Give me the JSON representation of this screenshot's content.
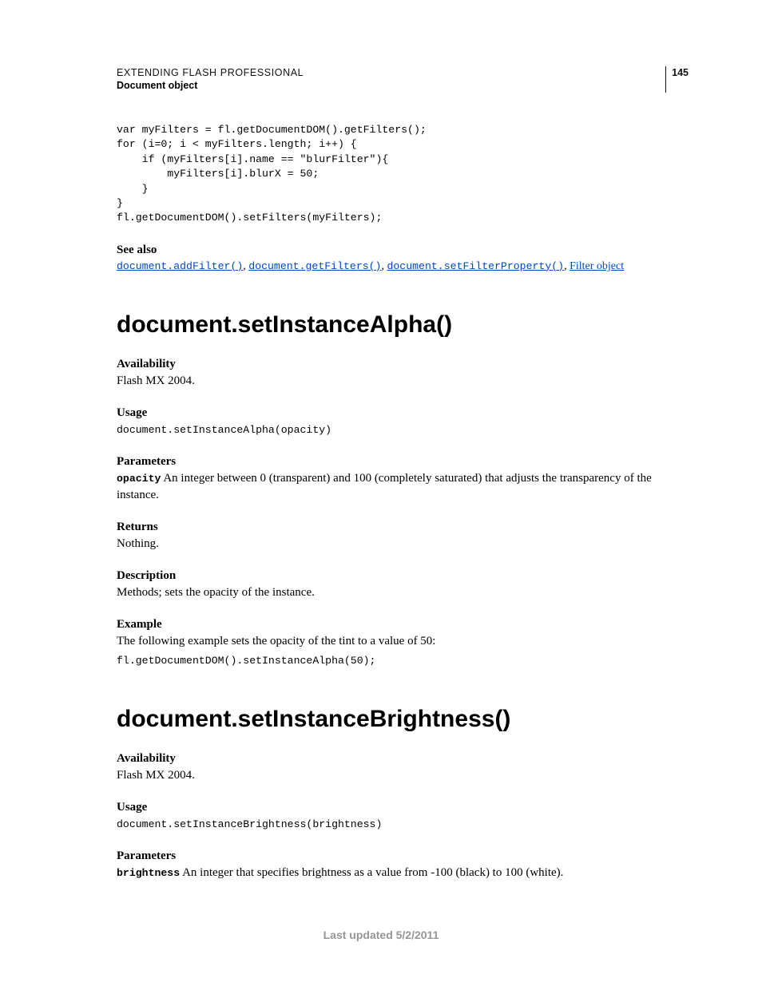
{
  "header": {
    "title": "EXTENDING FLASH PROFESSIONAL",
    "subtitle": "Document object",
    "page_number": "145"
  },
  "code1": "var myFilters = fl.getDocumentDOM().getFilters();\nfor (i=0; i < myFilters.length; i++) {\n    if (myFilters[i].name == \"blurFilter\"){\n        myFilters[i].blurX = 50;\n    }\n}\nfl.getDocumentDOM().setFilters(myFilters);",
  "see_also": {
    "label": "See also",
    "links": {
      "l1": "document.addFilter()",
      "l2": "document.getFilters()",
      "l3": "document.setFilterProperty()",
      "l4": "Filter object"
    }
  },
  "methodA": {
    "title": "document.setInstanceAlpha()",
    "availability_label": "Availability",
    "availability_text": "Flash MX 2004.",
    "usage_label": "Usage",
    "usage_code": "document.setInstanceAlpha(opacity)",
    "parameters_label": "Parameters",
    "param_name": "opacity",
    "param_text": " An integer between 0 (transparent) and 100 (completely saturated) that adjusts the transparency of the instance.",
    "returns_label": "Returns",
    "returns_text": "Nothing.",
    "description_label": "Description",
    "description_text": "Methods; sets the opacity of the instance.",
    "example_label": "Example",
    "example_text": "The following example sets the opacity of the tint to a value of 50:",
    "example_code": "fl.getDocumentDOM().setInstanceAlpha(50);"
  },
  "methodB": {
    "title": "document.setInstanceBrightness()",
    "availability_label": "Availability",
    "availability_text": "Flash MX 2004.",
    "usage_label": "Usage",
    "usage_code": "document.setInstanceBrightness(brightness)",
    "parameters_label": "Parameters",
    "param_name": "brightness",
    "param_text": " An integer that specifies brightness as a value from -100 (black) to 100 (white)."
  },
  "footer": "Last updated 5/2/2011"
}
